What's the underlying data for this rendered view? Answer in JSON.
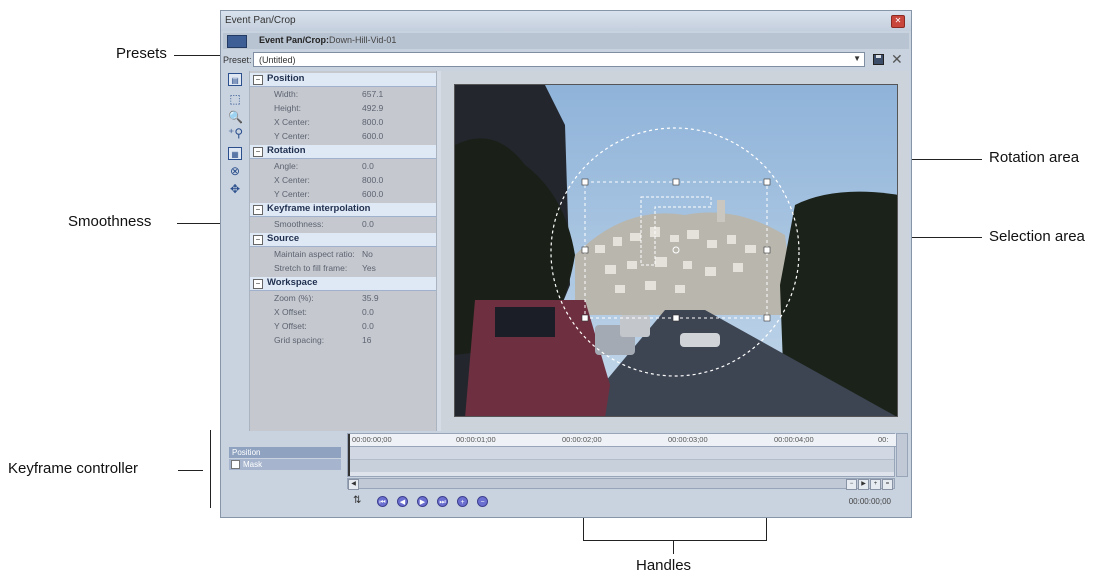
{
  "window": {
    "title": "Event Pan/Crop",
    "header_title": "Event Pan/Crop:",
    "header_subtitle": "Down-Hill-Vid-01",
    "preset_label": "Preset:",
    "preset_value": "(Untitled)"
  },
  "callouts": {
    "presets": "Presets",
    "smoothness": "Smoothness",
    "keyframe_controller": "Keyframe controller",
    "rotation_area": "Rotation area",
    "selection_area": "Selection area",
    "handles": "Handles"
  },
  "properties": {
    "position": {
      "header": "Position",
      "rows": [
        {
          "k": "Width:",
          "v": "657.1"
        },
        {
          "k": "Height:",
          "v": "492.9"
        },
        {
          "k": "X Center:",
          "v": "800.0"
        },
        {
          "k": "Y Center:",
          "v": "600.0"
        }
      ]
    },
    "rotation": {
      "header": "Rotation",
      "rows": [
        {
          "k": "Angle:",
          "v": "0.0"
        },
        {
          "k": "X Center:",
          "v": "800.0"
        },
        {
          "k": "Y Center:",
          "v": "600.0"
        }
      ]
    },
    "keyframe": {
      "header": "Keyframe interpolation",
      "rows": [
        {
          "k": "Smoothness:",
          "v": "0.0"
        }
      ]
    },
    "source": {
      "header": "Source",
      "rows": [
        {
          "k": "Maintain aspect ratio:",
          "v": "No"
        },
        {
          "k": "Stretch to fill frame:",
          "v": "Yes"
        }
      ]
    },
    "workspace": {
      "header": "Workspace",
      "rows": [
        {
          "k": "Zoom (%):",
          "v": "35.9"
        },
        {
          "k": "X Offset:",
          "v": "0.0"
        },
        {
          "k": "Y Offset:",
          "v": "0.0"
        },
        {
          "k": "Grid spacing:",
          "v": "16"
        }
      ]
    }
  },
  "keyframe_panel": {
    "track_position": "Position",
    "track_mask": "Mask",
    "timecodes": [
      "00:00:00;00",
      "00:00:01;00",
      "00:00:02;00",
      "00:00:03;00",
      "00:00:04;00",
      "00:"
    ],
    "current_time": "00:00:00;00"
  }
}
